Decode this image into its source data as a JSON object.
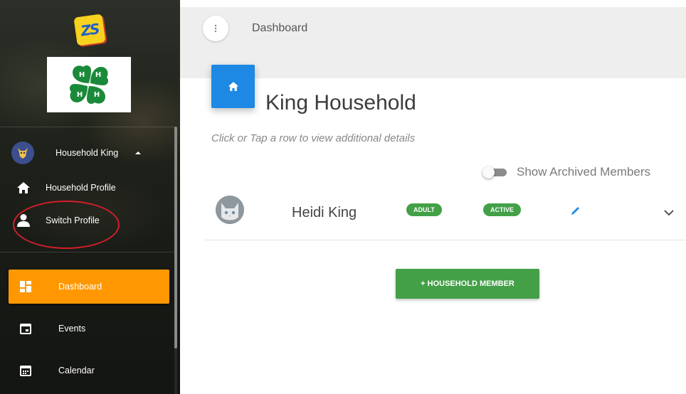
{
  "sidebar": {
    "user": {
      "name": "Household King"
    },
    "profile_links": [
      {
        "label": "Household Profile",
        "icon": "home-icon"
      },
      {
        "label": "Switch Profile",
        "icon": "person-icon"
      }
    ],
    "nav": [
      {
        "label": "Dashboard",
        "icon": "dashboard-icon",
        "active": true
      },
      {
        "label": "Events",
        "icon": "event-icon",
        "active": false
      },
      {
        "label": "Calendar",
        "icon": "calendar-icon",
        "active": false
      }
    ],
    "annotation_color": "#d11f2a",
    "active_color": "#ff9800"
  },
  "header": {
    "breadcrumb": "Dashboard",
    "menu_icon": "more-vert-icon"
  },
  "household": {
    "title": "King Household",
    "hint": "Click or Tap a row to view additional details",
    "archived_toggle": {
      "label": "Show Archived Members",
      "on": false
    },
    "members": [
      {
        "name": "Heidi King",
        "role_badge": "ADULT",
        "status_badge": "ACTIVE"
      }
    ],
    "add_button": "+ HOUSEHOLD MEMBER"
  },
  "colors": {
    "primary": "#1e88e5",
    "success": "#43a047",
    "accent": "#ff9800"
  }
}
